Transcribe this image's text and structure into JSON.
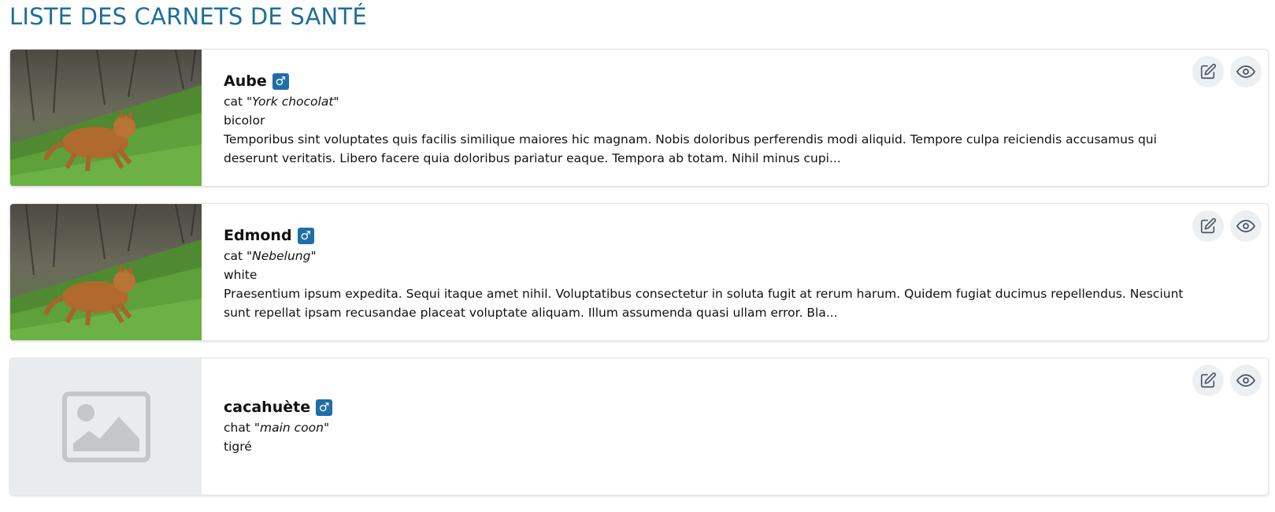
{
  "page": {
    "title": "LISTE DES CARNETS DE SANTÉ"
  },
  "sex_symbol": "♂",
  "colors": {
    "title": "#1d6d9e",
    "badge": "#1f6fa6",
    "action_bg": "#edf0f3"
  },
  "icons": {
    "edit": "pencil-square-icon",
    "view": "eye-icon",
    "placeholder": "image-placeholder-icon"
  },
  "cards": [
    {
      "name": "Aube",
      "species": "cat",
      "breed": "\"York chocolat\"",
      "color": "bicolor",
      "description": "Temporibus sint voluptates quis facilis similique maiores hic magnam. Nobis doloribus perferendis modi aliquid. Tempore culpa reiciendis accusamus qui deserunt veritatis. Libero facere quia doloribus pariatur eaque. Tempora ab totam. Nihil minus cupi..."
    },
    {
      "name": "Edmond",
      "species": "cat",
      "breed": "\"Nebelung\"",
      "color": "white",
      "description": "Praesentium ipsum expedita. Sequi itaque amet nihil. Voluptatibus consectetur in soluta fugit at rerum harum. Quidem fugiat ducimus repellendus. Nesciunt sunt repellat ipsam recusandae placeat voluptate aliquam. Illum assumenda quasi ullam error. Bla..."
    },
    {
      "name": "cacahuète",
      "species": "chat",
      "breed": "\"main coon\"",
      "color": "tigré",
      "description": ""
    }
  ]
}
